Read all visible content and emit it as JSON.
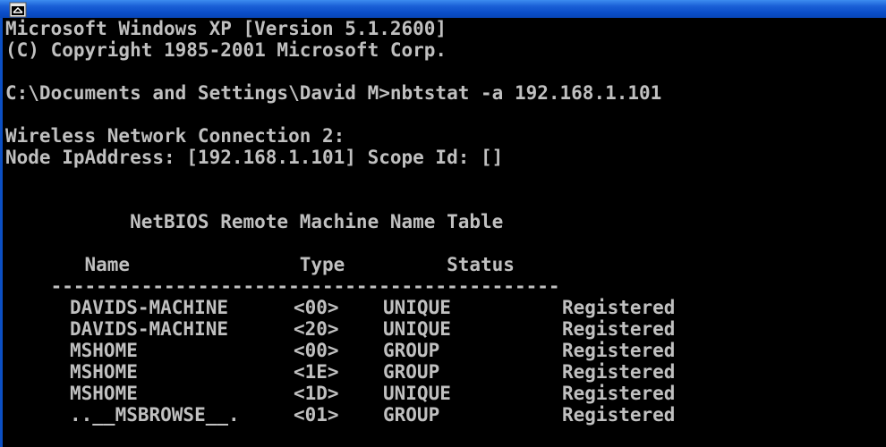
{
  "window": {
    "title": "",
    "icon": "cmd-icon"
  },
  "console": {
    "lines": [
      "Microsoft Windows XP [Version 5.1.2600]",
      "(C) Copyright 1985-2001 Microsoft Corp.",
      "",
      "C:\\Documents and Settings\\David M>nbtstat -a 192.168.1.101",
      "",
      "Wireless Network Connection 2:",
      "Node IpAddress: [192.168.1.101] Scope Id: []",
      "",
      "           NetBIOS Remote Machine Name Table",
      "",
      "       Name               Type         Status",
      "    ---------------------------------------------"
    ],
    "rows": [
      {
        "name": "DAVIDS-MACHINE",
        "suffix": "<00>",
        "type": "UNIQUE",
        "status": "Registered"
      },
      {
        "name": "DAVIDS-MACHINE",
        "suffix": "<20>",
        "type": "UNIQUE",
        "status": "Registered"
      },
      {
        "name": "MSHOME",
        "suffix": "<00>",
        "type": "GROUP",
        "status": "Registered"
      },
      {
        "name": "MSHOME",
        "suffix": "<1E>",
        "type": "GROUP",
        "status": "Registered"
      },
      {
        "name": "MSHOME",
        "suffix": "<1D>",
        "type": "UNIQUE",
        "status": "Registered"
      },
      {
        "name": "..__MSBROWSE__.",
        "suffix": "<01>",
        "type": "GROUP",
        "status": "Registered"
      }
    ]
  },
  "colors": {
    "console_bg": "#000000",
    "console_text": "#c0c0c0",
    "titlebar": "#0a4ec9"
  }
}
